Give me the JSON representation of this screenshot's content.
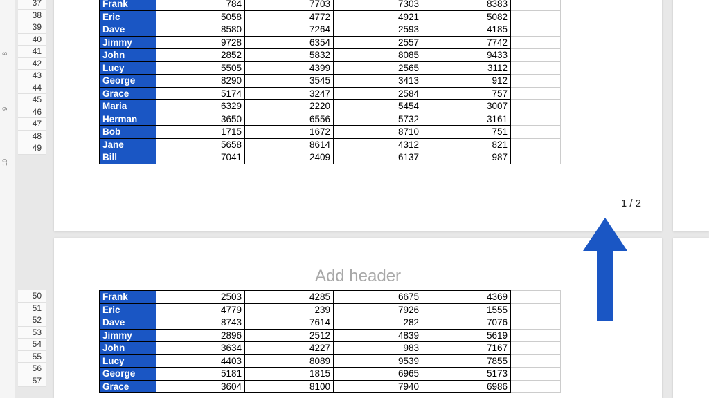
{
  "page_number_label": "1 / 2",
  "add_header_text": "Add header",
  "ruler_marks": [
    "8",
    "9",
    "10"
  ],
  "row_numbers_page1": [
    37,
    38,
    39,
    40,
    41,
    42,
    43,
    44,
    45,
    46,
    47,
    48,
    49
  ],
  "row_numbers_page2": [
    50,
    51,
    52,
    53,
    54,
    55,
    56,
    57
  ],
  "page1": {
    "rows": [
      {
        "name": "Frank",
        "v": [
          "784",
          "7703",
          "7303",
          "8383"
        ]
      },
      {
        "name": "Eric",
        "v": [
          "5058",
          "4772",
          "4921",
          "5082"
        ]
      },
      {
        "name": "Dave",
        "v": [
          "8580",
          "7264",
          "2593",
          "4185"
        ]
      },
      {
        "name": "Jimmy",
        "v": [
          "9728",
          "6354",
          "2557",
          "7742"
        ]
      },
      {
        "name": "John",
        "v": [
          "2852",
          "5832",
          "8085",
          "9433"
        ]
      },
      {
        "name": "Lucy",
        "v": [
          "5505",
          "4399",
          "2565",
          "3112"
        ]
      },
      {
        "name": "George",
        "v": [
          "8290",
          "3545",
          "3413",
          "912"
        ]
      },
      {
        "name": "Grace",
        "v": [
          "5174",
          "3247",
          "2584",
          "757"
        ]
      },
      {
        "name": "Maria",
        "v": [
          "6329",
          "2220",
          "5454",
          "3007"
        ]
      },
      {
        "name": "Herman",
        "v": [
          "3650",
          "6556",
          "5732",
          "3161"
        ]
      },
      {
        "name": "Bob",
        "v": [
          "1715",
          "1672",
          "8710",
          "751"
        ]
      },
      {
        "name": "Jane",
        "v": [
          "5658",
          "8614",
          "4312",
          "821"
        ]
      },
      {
        "name": "Bill",
        "v": [
          "7041",
          "2409",
          "6137",
          "987"
        ]
      }
    ]
  },
  "page2": {
    "rows": [
      {
        "name": "Frank",
        "v": [
          "2503",
          "4285",
          "6675",
          "4369"
        ]
      },
      {
        "name": "Eric",
        "v": [
          "4779",
          "239",
          "7926",
          "1555"
        ]
      },
      {
        "name": "Dave",
        "v": [
          "8743",
          "7614",
          "282",
          "7076"
        ]
      },
      {
        "name": "Jimmy",
        "v": [
          "2896",
          "2512",
          "4839",
          "5619"
        ]
      },
      {
        "name": "John",
        "v": [
          "3634",
          "4227",
          "983",
          "7167"
        ]
      },
      {
        "name": "Lucy",
        "v": [
          "4403",
          "8089",
          "9539",
          "7855"
        ]
      },
      {
        "name": "George",
        "v": [
          "5181",
          "1815",
          "6965",
          "5173"
        ]
      },
      {
        "name": "Grace",
        "v": [
          "3604",
          "8100",
          "7940",
          "6986"
        ]
      }
    ]
  }
}
